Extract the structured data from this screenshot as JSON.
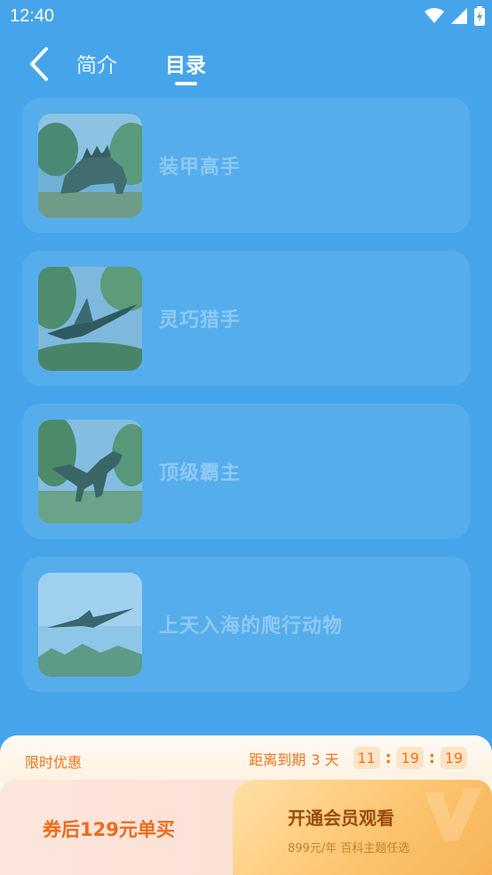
{
  "status_bar": {
    "time": "12:40"
  },
  "nav": {
    "tabs": [
      {
        "label": "简介",
        "active": false
      },
      {
        "label": "目录",
        "active": true
      }
    ]
  },
  "chapters": [
    {
      "title": "装甲高手",
      "thumb": "stegosaurus"
    },
    {
      "title": "灵巧猎手",
      "thumb": "flying-reptile"
    },
    {
      "title": "顶级霸主",
      "thumb": "theropod"
    },
    {
      "title": "上天入海的爬行动物",
      "thumb": "pterosaur"
    }
  ],
  "promo": {
    "label": "限时优惠",
    "countdown_prefix": "距离到期",
    "days": "3 天",
    "hours": "11",
    "minutes": "19",
    "seconds": "19",
    "buy_once_label": "券后129元单买",
    "vip_title": "开通会员观看",
    "vip_subtitle": "899元/年 百科主题任选"
  },
  "colors": {
    "background": "#46a5ea",
    "card": "#55adec",
    "accent_orange": "#f2751b"
  }
}
